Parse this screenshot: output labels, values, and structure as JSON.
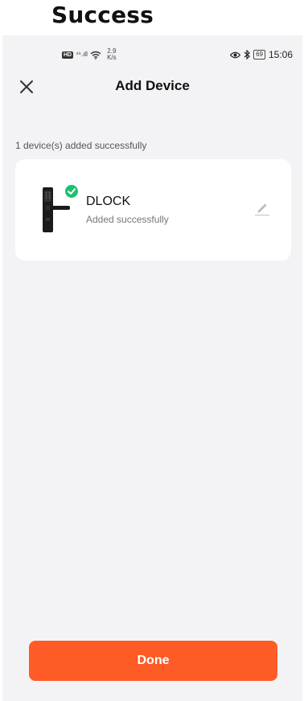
{
  "banner": {
    "title": "Success"
  },
  "status_bar": {
    "hd_badge": "HD",
    "signal": "⁴⁶.ıll",
    "net_speed_value": "2.9",
    "net_speed_unit": "K/s",
    "battery": "69",
    "time": "15:06",
    "icons": [
      "hd-icon",
      "signal-icon",
      "wifi-icon",
      "eye-icon",
      "bluetooth-icon",
      "battery-icon"
    ]
  },
  "header": {
    "title": "Add Device",
    "close_icon": "close-icon"
  },
  "summary": {
    "text": "1 device(s) added successfully"
  },
  "device": {
    "name": "DLOCK",
    "status": "Added successfully",
    "icons": [
      "smart-lock-image",
      "check-icon",
      "edit-pencil-icon"
    ]
  },
  "footer": {
    "done_label": "Done"
  },
  "colors": {
    "accent": "#ff5b26",
    "success": "#1fbf75",
    "background": "#f3f3f5"
  }
}
